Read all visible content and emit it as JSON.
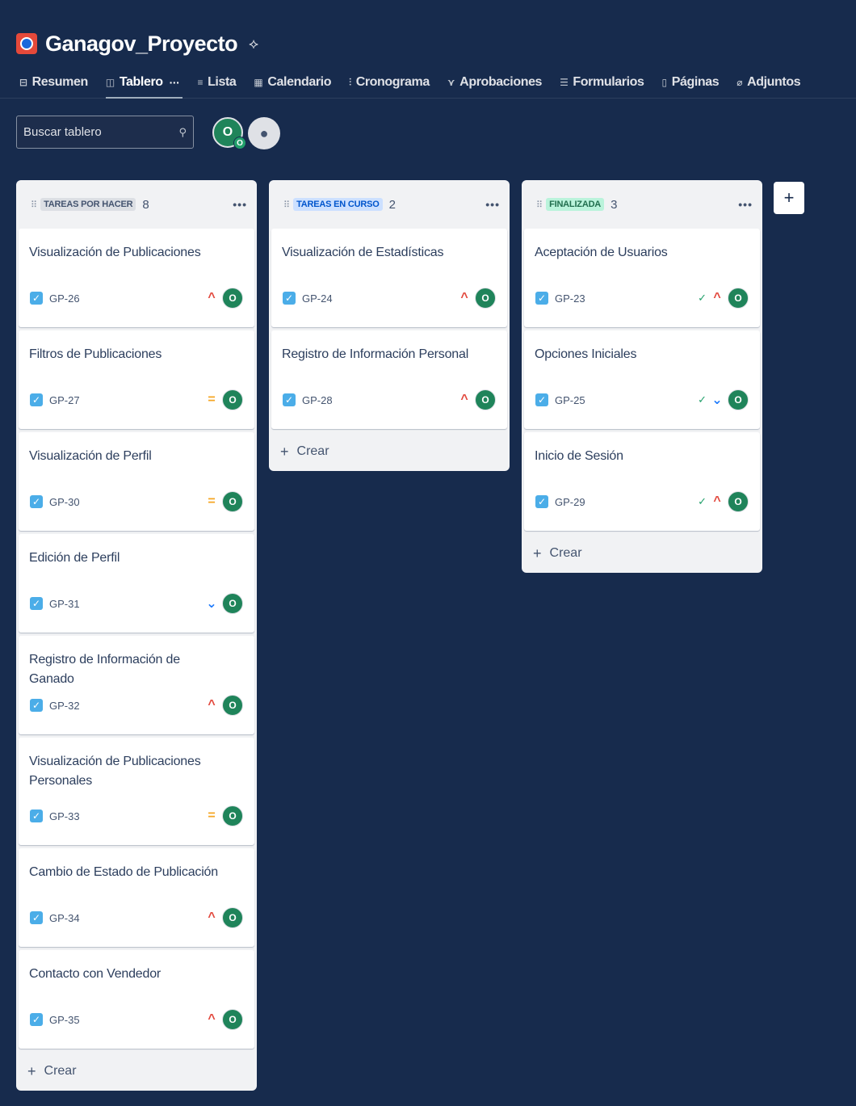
{
  "project": {
    "title": "Ganagov_Proyecto",
    "logo_icon": "project-logo-icon",
    "pin_icon": "pin-icon"
  },
  "tabs": [
    {
      "label": "Resumen",
      "icon": "⊟"
    },
    {
      "label": "Tablero",
      "icon": "◫",
      "more": "···",
      "active": true
    },
    {
      "label": "Lista",
      "icon": "≡"
    },
    {
      "label": "Calendario",
      "icon": "▦"
    },
    {
      "label": "Cronograma",
      "icon": "⫶"
    },
    {
      "label": "Aprobaciones",
      "icon": "⋎"
    },
    {
      "label": "Formularios",
      "icon": "☰"
    },
    {
      "label": "Páginas",
      "icon": "▯"
    },
    {
      "label": "Adjuntos",
      "icon": "⌀"
    }
  ],
  "search": {
    "placeholder": "Buscar tablero",
    "icon": "⚲"
  },
  "avatar": {
    "letter": "O",
    "sub": "O"
  },
  "add_people_icon": "add-people-icon",
  "columns": [
    {
      "lozenge": "TAREAS POR HACER",
      "count": "8",
      "menu": "•••",
      "create": "Crear",
      "cards": [
        {
          "title": "Visualización de Publicaciones",
          "key": "GP-26",
          "priority": "high",
          "avatar": "O"
        },
        {
          "title": "Filtros de Publicaciones",
          "key": "GP-27",
          "priority": "medium",
          "avatar": "O"
        },
        {
          "title": "Visualización de Perfil",
          "key": "GP-30",
          "priority": "medium",
          "avatar": "O"
        },
        {
          "title": "Edición de Perfil",
          "key": "GP-31",
          "priority": "low",
          "avatar": "O"
        },
        {
          "title": "Registro de Información de Ganado",
          "key": "GP-32",
          "priority": "high",
          "avatar": "O"
        },
        {
          "title": "Visualización de Publicaciones Personales",
          "key": "GP-33",
          "priority": "medium",
          "avatar": "O"
        },
        {
          "title": "Cambio de Estado de Publicación",
          "key": "GP-34",
          "priority": "high",
          "avatar": "O"
        },
        {
          "title": "Contacto con Vendedor",
          "key": "GP-35",
          "priority": "high",
          "avatar": "O"
        }
      ]
    },
    {
      "lozenge": "TAREAS EN CURSO",
      "count": "2",
      "menu": "•••",
      "create": "Crear",
      "cards": [
        {
          "title": "Visualización de Estadísticas",
          "key": "GP-24",
          "priority": "high",
          "avatar": "O"
        },
        {
          "title": "Registro de Información Personal",
          "key": "GP-28",
          "priority": "high",
          "avatar": "O"
        }
      ]
    },
    {
      "lozenge": "FINALIZADA",
      "count": "3",
      "menu": "•••",
      "create": "Crear",
      "cards": [
        {
          "title": "Aceptación de Usuarios",
          "key": "GP-23",
          "priority": "high",
          "done": true,
          "avatar": "O"
        },
        {
          "title": "Opciones Iniciales",
          "key": "GP-25",
          "priority": "low",
          "done": true,
          "avatar": "O"
        },
        {
          "title": "Inicio de Sesión",
          "key": "GP-29",
          "priority": "high",
          "done": true,
          "avatar": "O"
        }
      ]
    }
  ],
  "add_column": "+",
  "glyphs": {
    "check": "✓",
    "plus": "+",
    "drag": "⠿",
    "high": "^",
    "medium": "=",
    "low": "⌄",
    "done": "✓"
  }
}
